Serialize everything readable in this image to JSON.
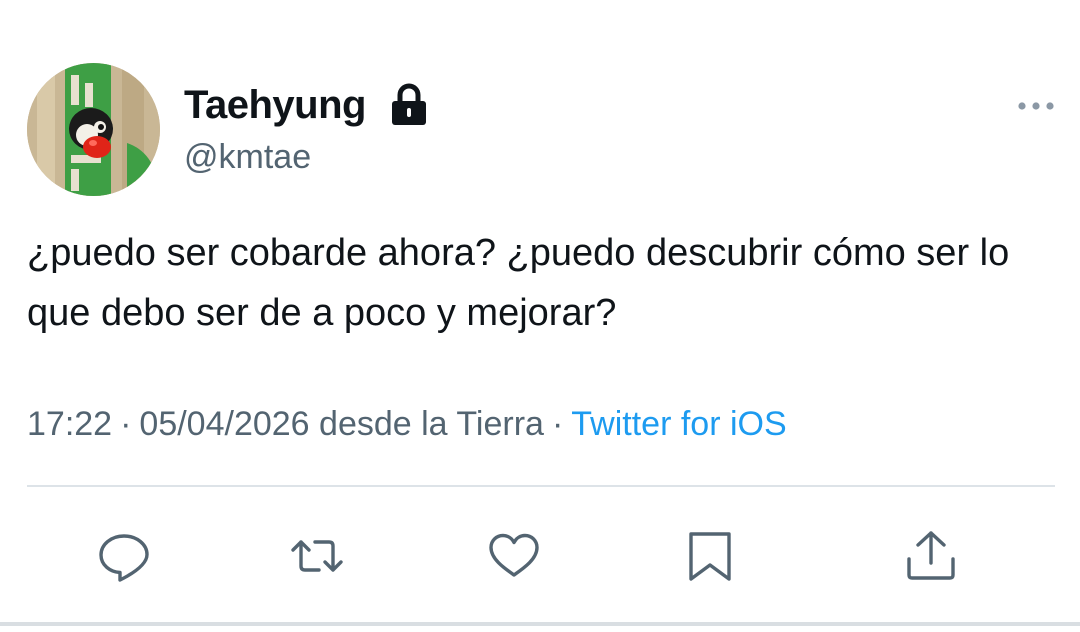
{
  "tweet": {
    "author": {
      "display_name": "Taehyung",
      "handle": "@kmtae",
      "protected": true,
      "avatar": "penguin-on-paper-bag-photo"
    },
    "text": "¿puedo ser cobarde ahora? ¿puedo descubrir cómo ser lo que debo ser de a poco y mejorar?",
    "time": "17:22",
    "date": "05/04/2026",
    "location": "desde la Tierra",
    "separator": "·",
    "source": "Twitter for iOS"
  },
  "icons": {
    "lock": "lock-icon",
    "more": "more-dots-icon",
    "reply": "reply-icon",
    "retweet": "retweet-icon",
    "like": "heart-icon",
    "bookmark": "bookmark-icon",
    "share": "share-icon"
  },
  "colors": {
    "text": "#0f1419",
    "secondary_text": "#536471",
    "link": "#1d9bf0",
    "divider": "#dde3e8",
    "icon": "#536471"
  }
}
